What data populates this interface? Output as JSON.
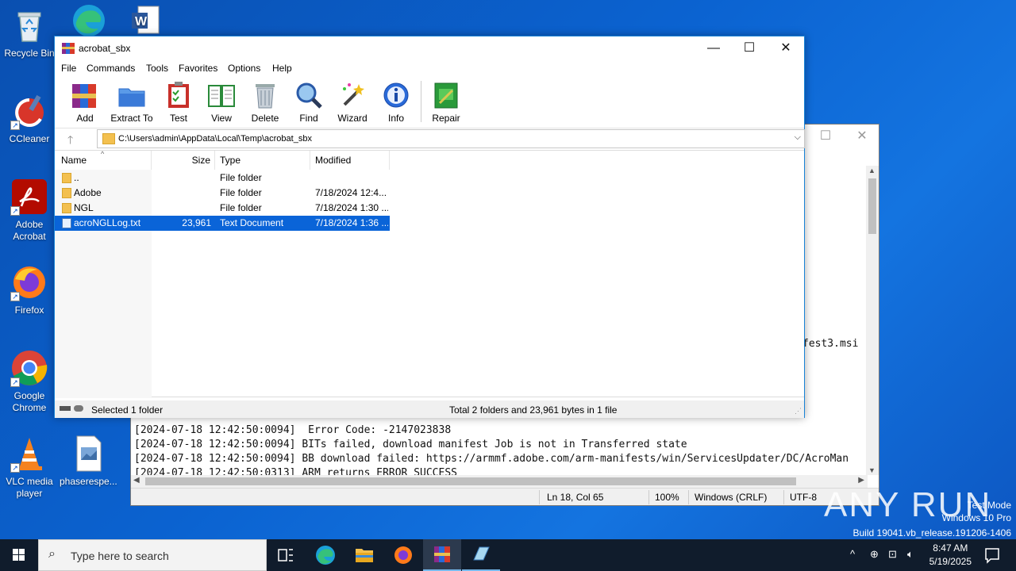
{
  "desktop": {
    "icons": [
      {
        "label": "Recycle Bin",
        "icon": "recycle-bin-icon"
      },
      {
        "label": "CCleaner",
        "icon": "ccleaner-icon"
      },
      {
        "label": "Adobe Acrobat",
        "icon": "adobe-acrobat-icon"
      },
      {
        "label": "Firefox",
        "icon": "firefox-icon"
      },
      {
        "label": "Google Chrome",
        "icon": "chrome-icon"
      },
      {
        "label": "VLC media player",
        "icon": "vlc-icon"
      },
      {
        "label": "phaserespe...",
        "icon": "image-file-icon"
      }
    ]
  },
  "notepad": {
    "lines": [
      "[2024-07-18 12:42:50:0094]  Error Code: -2147023838",
      "[2024-07-18 12:42:50:0094] BITs failed, download manifest Job is not in Transferred state",
      "[2024-07-18 12:42:50:0094] BB download failed: https://armmf.adobe.com/arm-manifests/win/ServicesUpdater/DC/AcroMan",
      "[2024-07-18 12:42:50:0313] ARM returns ERROR_SUCCESS"
    ],
    "fragment": "fest3.msi",
    "status": {
      "position": "Ln 18, Col 65",
      "zoom": "100%",
      "line_ending": "Windows (CRLF)",
      "encoding": "UTF-8"
    }
  },
  "winrar": {
    "title": "acrobat_sbx",
    "menu": [
      "File",
      "Commands",
      "Tools",
      "Favorites",
      "Options",
      "Help"
    ],
    "toolbar": [
      {
        "label": "Add",
        "icon": "add-archive-icon"
      },
      {
        "label": "Extract To",
        "icon": "extract-folder-icon"
      },
      {
        "label": "Test",
        "icon": "test-clipboard-icon"
      },
      {
        "label": "View",
        "icon": "view-book-icon"
      },
      {
        "label": "Delete",
        "icon": "delete-trash-icon"
      },
      {
        "label": "Find",
        "icon": "find-magnifier-icon"
      },
      {
        "label": "Wizard",
        "icon": "wizard-wand-icon"
      },
      {
        "label": "Info",
        "icon": "info-icon"
      },
      {
        "label": "Repair",
        "icon": "repair-kit-icon"
      }
    ],
    "path": "C:\\Users\\admin\\AppData\\Local\\Temp\\acrobat_sbx",
    "columns": {
      "name": "Name",
      "size": "Size",
      "type": "Type",
      "modified": "Modified"
    },
    "rows": [
      {
        "name": "..",
        "size": "",
        "type": "File folder",
        "modified": "",
        "kind": "folder"
      },
      {
        "name": "Adobe",
        "size": "",
        "type": "File folder",
        "modified": "7/18/2024 12:4...",
        "kind": "folder"
      },
      {
        "name": "NGL",
        "size": "",
        "type": "File folder",
        "modified": "7/18/2024 1:30 ...",
        "kind": "folder"
      },
      {
        "name": "acroNGLLog.txt",
        "size": "23,961",
        "type": "Text Document",
        "modified": "7/18/2024 1:36 ...",
        "kind": "text"
      }
    ],
    "status_left": "Selected 1 folder",
    "status_right": "Total 2 folders and 23,961 bytes in 1 file"
  },
  "taskbar": {
    "search_placeholder": "Type here to search",
    "time": "8:47 AM",
    "date": "5/19/2025"
  },
  "watermark": {
    "brand": "ANY RUN",
    "mode": "Test Mode",
    "os": "Windows 10 Pro",
    "build": "Build 19041.vb_release.191206-1406"
  }
}
